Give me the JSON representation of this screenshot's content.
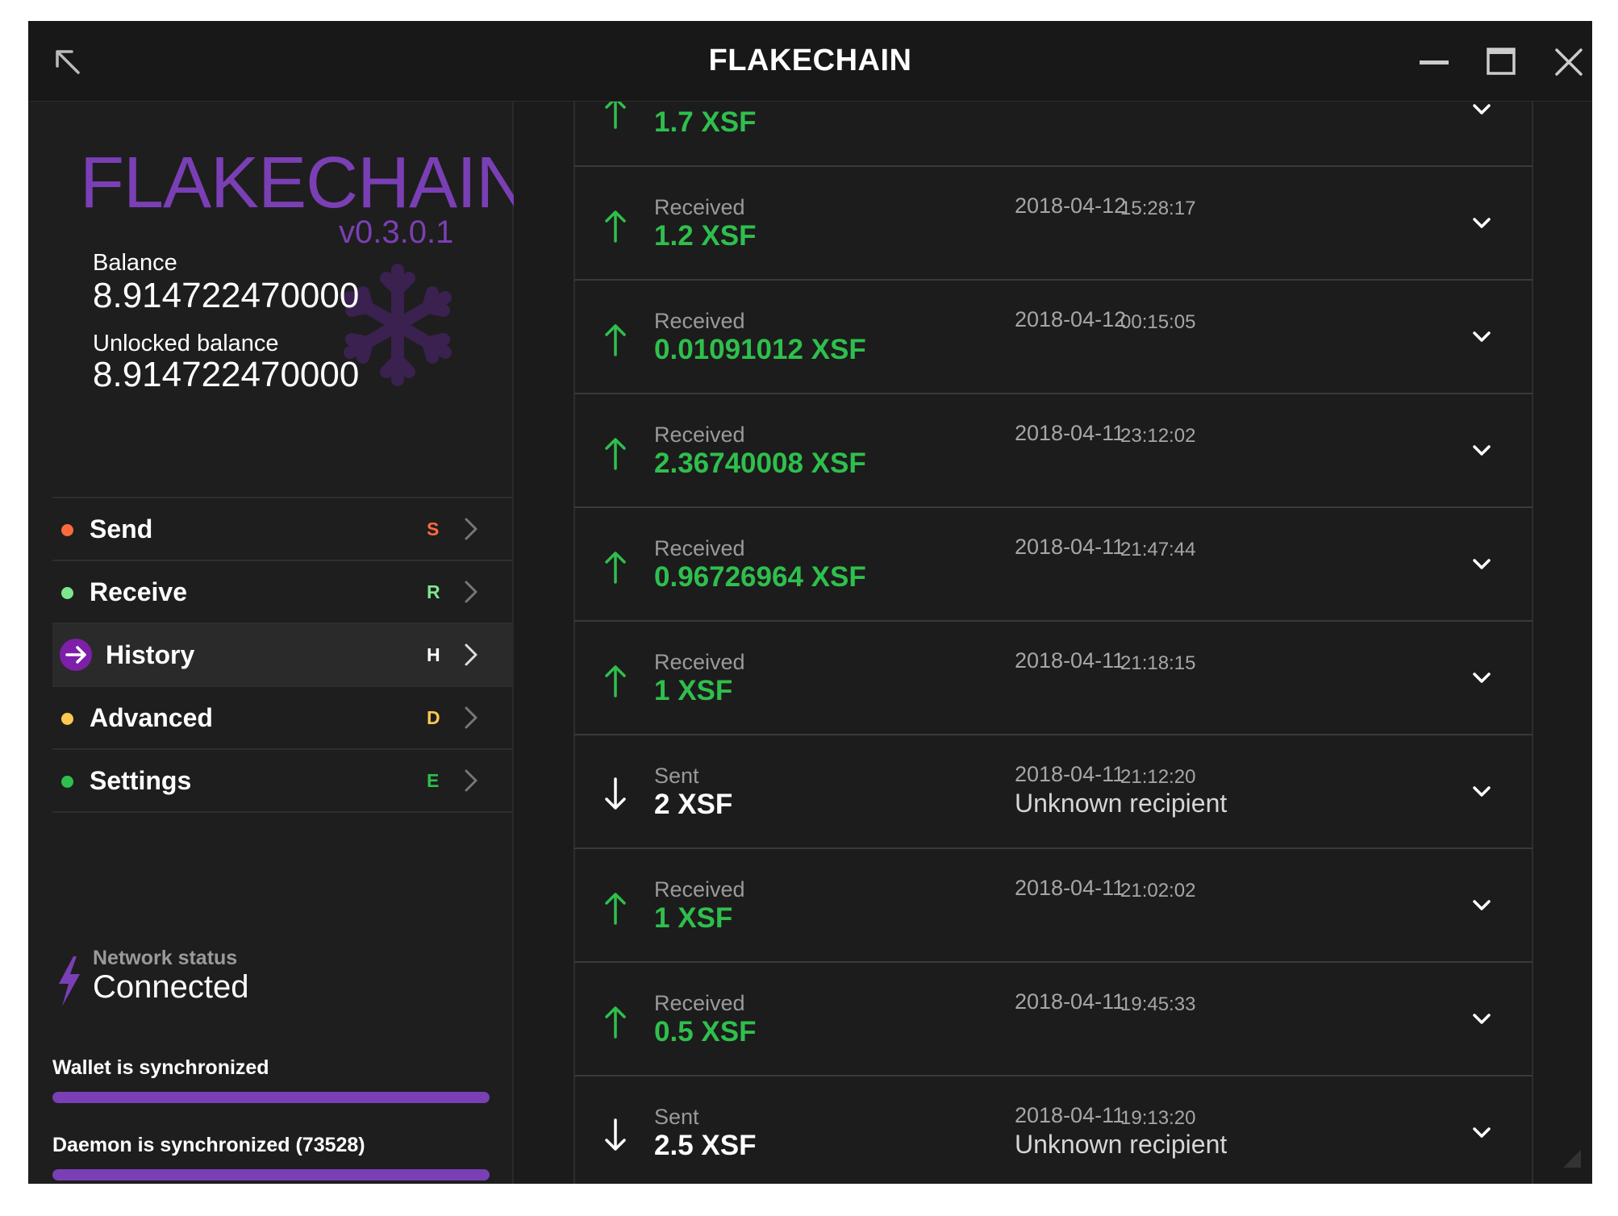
{
  "window": {
    "title": "FLAKECHAIN"
  },
  "sidebar": {
    "logo_text": "FLAKECHAIN",
    "version": "v0.3.0.1",
    "balance_label": "Balance",
    "balance_value": "8.914722470000",
    "unlocked_label": "Unlocked balance",
    "unlocked_value": "8.914722470000",
    "menu": [
      {
        "label": "Send",
        "shortcut": "S",
        "dot_color": "#ff6a3d",
        "shortcut_color": "#ff6a3d",
        "active": false
      },
      {
        "label": "Receive",
        "shortcut": "R",
        "dot_color": "#7de68e",
        "shortcut_color": "#7de68e",
        "active": false
      },
      {
        "label": "History",
        "shortcut": "H",
        "dot_color": "#7d1fa8",
        "shortcut_color": "#ffffff",
        "active": true
      },
      {
        "label": "Advanced",
        "shortcut": "D",
        "dot_color": "#ffc850",
        "shortcut_color": "#ffc850",
        "active": false
      },
      {
        "label": "Settings",
        "shortcut": "E",
        "dot_color": "#2fbf4d",
        "shortcut_color": "#2fbf4d",
        "active": false
      }
    ],
    "network_status_label": "Network status",
    "network_status_value": "Connected",
    "wallet_sync_label": "Wallet is synchronized",
    "wallet_sync_progress": 1.0,
    "daemon_sync_label": "Daemon is synchronized (73528)",
    "daemon_sync_progress": 1.0
  },
  "colors": {
    "accent": "#7a3fb5",
    "received": "#2fbf4d",
    "sent": "#ffffff"
  },
  "history": {
    "transactions": [
      {
        "type": "",
        "amount": "1.7 XSF",
        "direction": "in",
        "date": "",
        "time": "",
        "recipient": ""
      },
      {
        "type": "Received",
        "amount": "1.2 XSF",
        "direction": "in",
        "date": "2018-04-12",
        "time": "15:28:17",
        "recipient": ""
      },
      {
        "type": "Received",
        "amount": "0.01091012 XSF",
        "direction": "in",
        "date": "2018-04-12",
        "time": "00:15:05",
        "recipient": ""
      },
      {
        "type": "Received",
        "amount": "2.36740008 XSF",
        "direction": "in",
        "date": "2018-04-11",
        "time": "23:12:02",
        "recipient": ""
      },
      {
        "type": "Received",
        "amount": "0.96726964 XSF",
        "direction": "in",
        "date": "2018-04-11",
        "time": "21:47:44",
        "recipient": ""
      },
      {
        "type": "Received",
        "amount": "1 XSF",
        "direction": "in",
        "date": "2018-04-11",
        "time": "21:18:15",
        "recipient": ""
      },
      {
        "type": "Sent",
        "amount": "2 XSF",
        "direction": "out",
        "date": "2018-04-11",
        "time": "21:12:20",
        "recipient": "Unknown recipient"
      },
      {
        "type": "Received",
        "amount": "1 XSF",
        "direction": "in",
        "date": "2018-04-11",
        "time": "21:02:02",
        "recipient": ""
      },
      {
        "type": "Received",
        "amount": "0.5 XSF",
        "direction": "in",
        "date": "2018-04-11",
        "time": "19:45:33",
        "recipient": ""
      },
      {
        "type": "Sent",
        "amount": "2.5 XSF",
        "direction": "out",
        "date": "2018-04-11",
        "time": "19:13:20",
        "recipient": "Unknown recipient"
      }
    ]
  }
}
